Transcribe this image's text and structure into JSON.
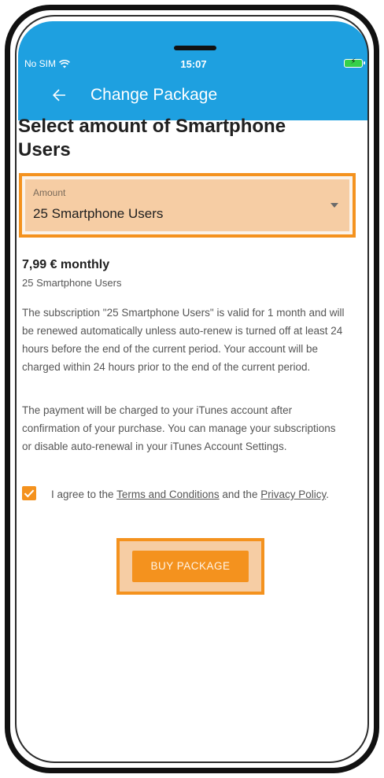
{
  "status_bar": {
    "carrier": "No SIM",
    "time": "15:07",
    "battery_charging": "⚡"
  },
  "app_bar": {
    "title": "Change Package",
    "back_icon": "arrow-left-icon",
    "color": "#1ea0e0"
  },
  "page": {
    "heading": "Select amount of Smartphone Users"
  },
  "amount_select": {
    "label": "Amount",
    "value": "25 Smartphone Users",
    "highlight_color": "#f4921e"
  },
  "package": {
    "price": "7,99 € monthly",
    "name": "25 Smartphone Users",
    "description": "The subscription \"25 Smartphone Users\" is valid for 1 month and will be renewed automatically unless auto-renew is turned off at least 24 hours before the end of the current period. Your account will be charged within 24 hours prior to the end of the current period.",
    "payment_info": "The payment will be charged to your iTunes account after confirmation of your purchase. You can manage your subscriptions or disable auto-renewal in your iTunes Account Settings."
  },
  "agreement": {
    "checked": true,
    "prefix": "I agree to the ",
    "terms_link": "Terms and Conditions",
    "middle": " and the ",
    "privacy_link": "Privacy Policy",
    "suffix": "."
  },
  "buy_button": {
    "label": "BUY PACKAGE",
    "color": "#f4921e"
  }
}
